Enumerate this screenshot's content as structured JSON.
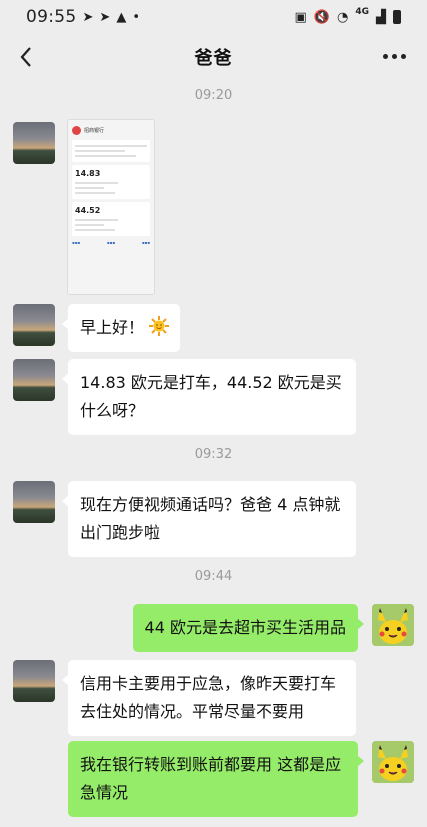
{
  "status": {
    "time": "09:55",
    "network": "4G"
  },
  "header": {
    "title": "爸爸"
  },
  "timestamps": [
    "09:20",
    "09:32",
    "09:44"
  ],
  "screenshot": {
    "bank_name": "招商银行",
    "amount1": "14.83",
    "amount2": "44.52"
  },
  "messages": [
    {
      "side": "left",
      "text": "早上好！"
    },
    {
      "side": "left",
      "text": "14.83 欧元是打车，44.52 欧元是买什么呀？"
    },
    {
      "side": "left",
      "text": "现在方便视频通话吗？爸爸 4 点钟就出门跑步啦"
    },
    {
      "side": "right",
      "text": "44 欧元是去超市买生活用品"
    },
    {
      "side": "left",
      "text": "信用卡主要用于应急，像昨天要打车去住处的情况。平常尽量不要用"
    },
    {
      "side": "right",
      "text": "我在银行转账到账前都要用 这都是应急情况"
    }
  ],
  "colors": {
    "background": "#ededed",
    "sent_bubble": "#95ec69",
    "received_bubble": "#ffffff",
    "timestamp": "#9a9a9a"
  }
}
